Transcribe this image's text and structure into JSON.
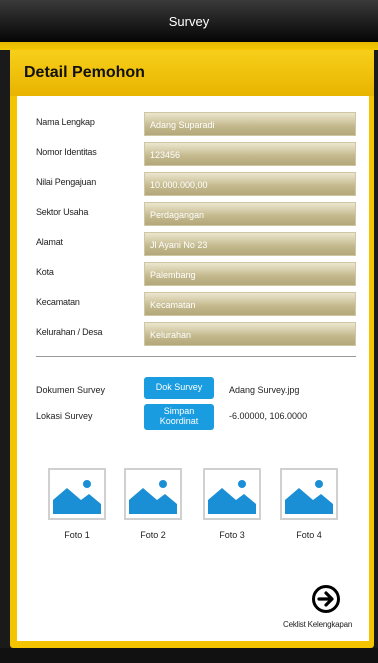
{
  "header": {
    "title": "Survey"
  },
  "section": {
    "title": "Detail Pemohon"
  },
  "fields": [
    {
      "label": "Nama Lengkap",
      "value": "Adang Suparadi"
    },
    {
      "label": "Nomor Identitas",
      "value": "123456"
    },
    {
      "label": "Nilai Pengajuan",
      "value": "10.000.000,00"
    },
    {
      "label": "Sektor Usaha",
      "value": "Perdagangan"
    },
    {
      "label": "Alamat",
      "value": "Jl Ayani No 23"
    },
    {
      "label": "Kota",
      "value": "Palembang"
    },
    {
      "label": "Kecamatan",
      "value": "Kecamatan"
    },
    {
      "label": "Kelurahan / Desa",
      "value": "Kelurahan"
    }
  ],
  "survey": {
    "doc_label": "Dokumen Survey",
    "doc_button": "Dok Survey",
    "doc_value": "Adang Survey.jpg",
    "loc_label": "Lokasi Survey",
    "loc_button": "Simpan Koordinat",
    "loc_value": "-6.00000, 106.0000"
  },
  "photos": [
    {
      "label": "Foto 1",
      "icon": "image-placeholder-icon"
    },
    {
      "label": "Foto 2",
      "icon": "image-placeholder-icon"
    },
    {
      "label": "Foto 3",
      "icon": "image-placeholder-icon"
    },
    {
      "label": "Foto 4",
      "icon": "image-placeholder-icon"
    }
  ],
  "next": {
    "label": "Ceklist Kelengkapan",
    "icon": "arrow-right-circle-icon"
  },
  "colors": {
    "accent": "#f5c400",
    "button": "#1a9ce0",
    "titlebar": "#000000"
  }
}
